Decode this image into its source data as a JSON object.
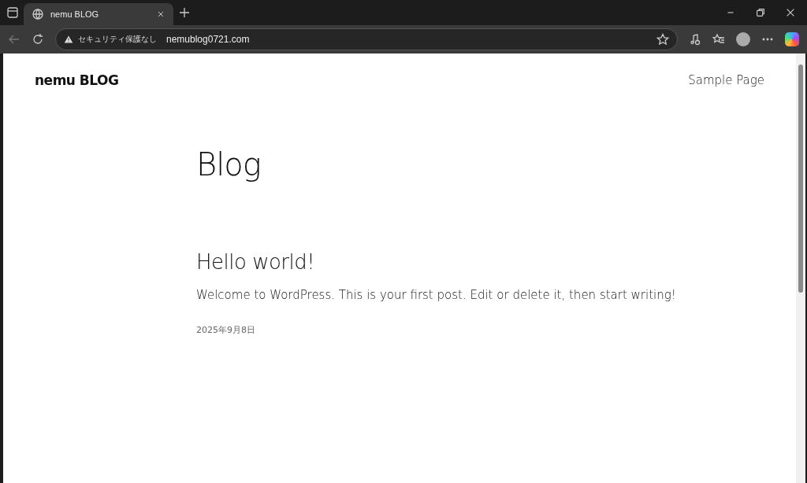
{
  "browser": {
    "tab": {
      "title": "nemu BLOG",
      "selected": true
    },
    "security_label": "セキュリティ保護なし",
    "url": "nemublog0721.com"
  },
  "site": {
    "title": "nemu BLOG",
    "nav": [
      "Sample Page"
    ]
  },
  "page": {
    "heading": "Blog",
    "posts": [
      {
        "title": "Hello world!",
        "excerpt": "Welcome to WordPress. This is your first post. Edit or delete it, then start writing!",
        "date": "2025年9月8日"
      }
    ]
  }
}
